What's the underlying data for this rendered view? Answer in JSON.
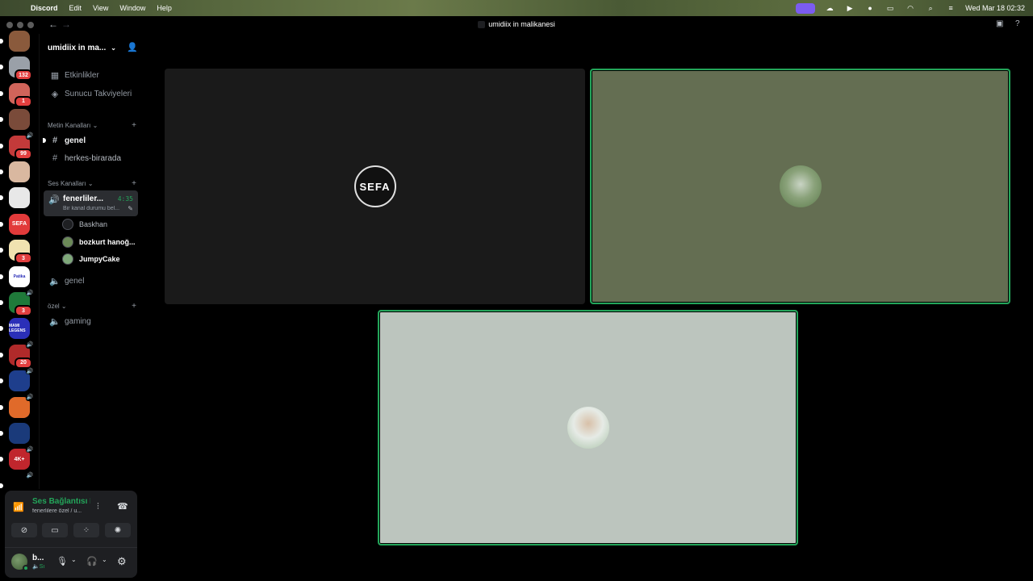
{
  "menubar": {
    "app": "Discord",
    "menus": [
      "Edit",
      "View",
      "Window",
      "Help"
    ],
    "clock": "Wed Mar 18  02:32",
    "share_color": "#7b5cf0"
  },
  "window": {
    "title": "umidiix in malikanesi"
  },
  "servers": [
    {
      "label": "",
      "color": "#8a5a3c"
    },
    {
      "label": "",
      "color": "#9aa0a8",
      "badge": "132"
    },
    {
      "label": "",
      "color": "#d0645a",
      "badge": "1"
    },
    {
      "label": "",
      "color": "#7a4b3a"
    },
    {
      "label": "",
      "color": "#c33a3a",
      "badge": "99",
      "voice": true
    },
    {
      "label": "",
      "color": "#d9b8a0"
    },
    {
      "label": "",
      "color": "#e8e8e8"
    },
    {
      "label": "SEFA",
      "color": "#e23a3a"
    },
    {
      "label": "",
      "color": "#f0e2b0",
      "badge": "3"
    },
    {
      "label": "Patika",
      "color": "#ffffff"
    },
    {
      "label": "",
      "color": "#1f7a3a",
      "badge": "3",
      "voice": true
    },
    {
      "label": "MAMI LEGENS",
      "color": "#2b2fb8"
    },
    {
      "label": "",
      "color": "#b02a2a",
      "badge": "20",
      "voice": true
    },
    {
      "label": "",
      "color": "#1e3e8c",
      "voice": true
    },
    {
      "label": "",
      "color": "#e06a2a",
      "voice": true
    },
    {
      "label": "",
      "color": "#1a3a7a"
    },
    {
      "label": "4K+",
      "color": "#c0262d",
      "voice": true
    },
    {
      "label": "",
      "color": "#000000",
      "voice": true
    }
  ],
  "server_header": {
    "name": "umidiix in ma...",
    "invite_icon": "add-member-icon"
  },
  "nav_items": [
    {
      "label": "Etkinlikler",
      "icon": "calendar-icon"
    },
    {
      "label": "Sunucu Takviyeleri",
      "icon": "boost-icon"
    }
  ],
  "text_category": "Metin Kanalları",
  "text_channels": [
    {
      "label": "genel",
      "unread": true
    },
    {
      "label": "herkes-birarada",
      "unread": false
    }
  ],
  "voice_category": "Ses Kanalları",
  "active_voice": {
    "name": "fenerliler...",
    "timer": "4:35",
    "status": "Bir kanal durumu bel..."
  },
  "voice_members": [
    {
      "name": "Baskhan",
      "color": "#1e1f22",
      "bold": false
    },
    {
      "name": "bozkurt hanoğ...",
      "color": "#6c8a58",
      "bold": true
    },
    {
      "name": "JumpyCake",
      "color": "#7fa87a",
      "bold": true
    }
  ],
  "other_voice": "genel",
  "private_category": "özel",
  "private_voice": "gaming",
  "connection": {
    "title": "Ses Bağlantısı K",
    "subtitle": "fenerlilere özel / u...",
    "username": "b...",
    "user_status": "Sı"
  },
  "tiles": [
    {
      "who": "Baskhan",
      "bg": "#1a1a1a",
      "avatar_text": "SEFA",
      "avatar_bg": "#111111",
      "speaking": false
    },
    {
      "who": "bozkurt",
      "bg": "#646e52",
      "avatar_text": "",
      "avatar_bg": "#8aa27a",
      "speaking": true
    },
    {
      "who": "JumpyCake",
      "bg": "#bcc5be",
      "avatar_text": "",
      "avatar_bg": "#e6ebe6",
      "speaking": true
    }
  ],
  "accent": "#23a55a"
}
